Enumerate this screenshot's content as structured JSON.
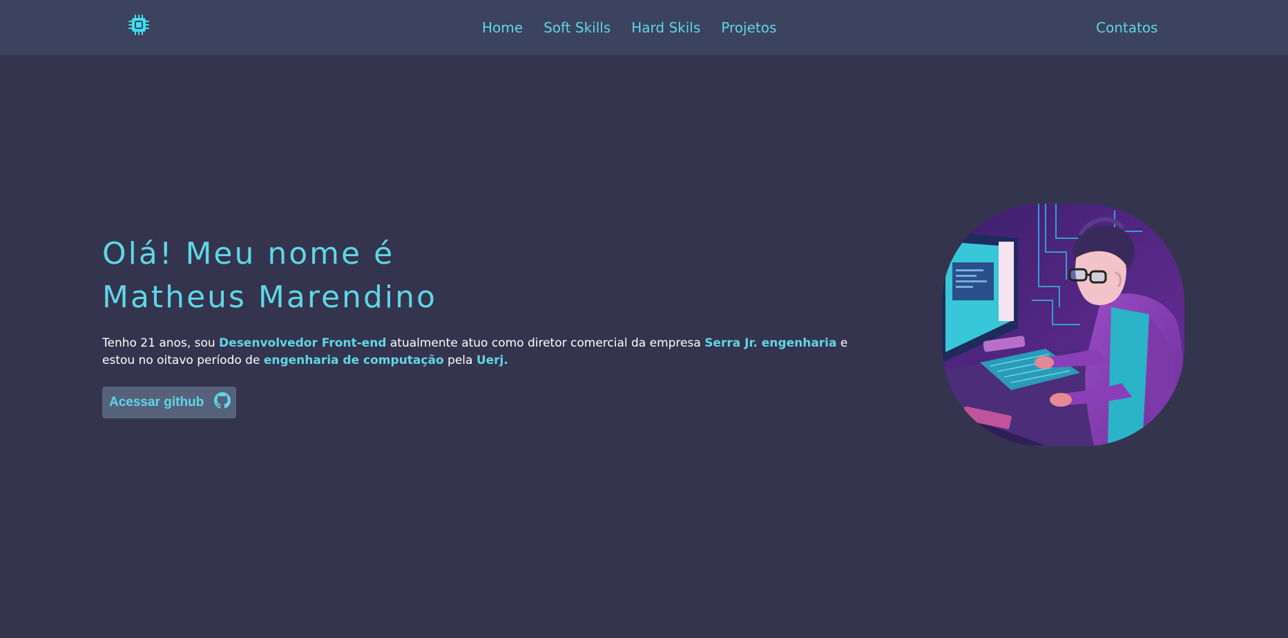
{
  "nav": {
    "logo_icon": "chip-icon",
    "links": [
      "Home",
      "Soft Skills",
      "Hard Skils",
      "Projetos"
    ],
    "contact": "Contatos"
  },
  "hero": {
    "title_line1": "Olá! Meu nome é",
    "title_line2": "Matheus Marendino",
    "bio": {
      "t1": "Tenho 21 anos, sou ",
      "h1": "Desenvolvedor Front-end",
      "t2": " atualmente atuo como diretor comercial da empresa ",
      "h2": "Serra Jr. engenharia",
      "t3": " e estou no oitavo período de ",
      "h3": "engenharia de computação",
      "t4": " pela ",
      "h4": "Uerj."
    },
    "button_label": "Acessar github",
    "button_icon": "github-icon",
    "avatar_illustration": "programmer-illustration"
  },
  "colors": {
    "background": "#35344e",
    "navbar": "#3b435e",
    "accent": "#5fd6e6",
    "text": "#ffffff",
    "button": "#56627a"
  }
}
